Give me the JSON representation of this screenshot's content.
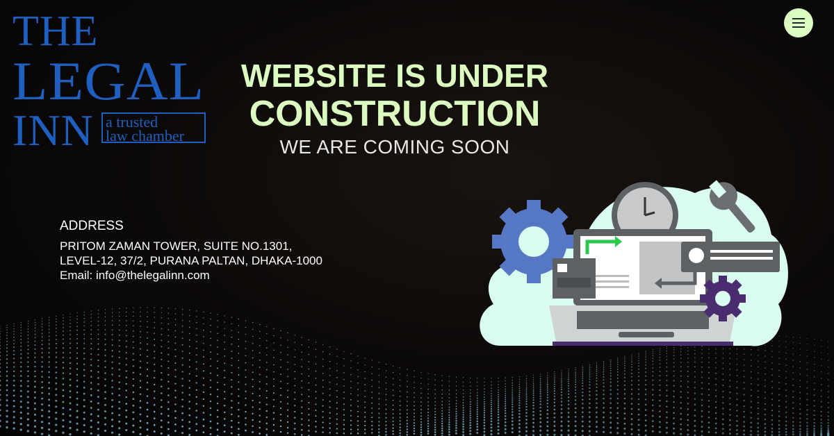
{
  "logo": {
    "line1": "THE",
    "line2": "LEGAL",
    "line3": "INN",
    "tagline1": "a trusted",
    "tagline2": "law chamber",
    "color": "#1f5fbf"
  },
  "menu": {
    "icon": "hamburger-menu-icon"
  },
  "hero": {
    "heading_line1": "WEBSITE IS UNDER",
    "heading_line2": "CONSTRUCTION",
    "subheading": "WE ARE COMING SOON",
    "accent": "#dcfbc0"
  },
  "address": {
    "title": "ADDRESS",
    "line1": "PRITOM ZAMAN TOWER, SUITE NO.1301,",
    "line2": "LEVEL-12, 37/2, PURANA PALTAN, DHAKA-1000",
    "email": "Email: info@thelegalinn.com"
  },
  "illustration": {
    "icons": [
      "gear-icon",
      "clock-icon",
      "wrench-icon",
      "laptop-icon",
      "arrow-icon"
    ]
  }
}
